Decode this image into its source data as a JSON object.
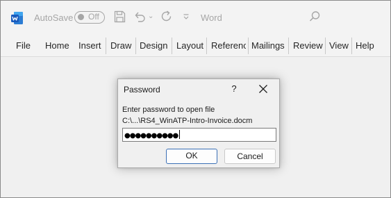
{
  "titlebar": {
    "app_icon": "word-icon",
    "autosave_label": "AutoSave",
    "autosave_state": "Off",
    "save_icon": "save-icon",
    "undo_icon": "undo-icon",
    "redo_icon": "redo-icon",
    "customize_icon": "customize-toolbar-icon",
    "app_name": "Word",
    "search_icon": "search-icon"
  },
  "ribbon": {
    "tabs": [
      "File",
      "Home",
      "Insert",
      "Draw",
      "Design",
      "Layout",
      "Referenc",
      "Mailings",
      "Review",
      "View",
      "Help"
    ]
  },
  "dialog": {
    "title": "Password",
    "help_label": "?",
    "close_icon": "close-icon",
    "prompt": "Enter password to open file",
    "file_path": "C:\\...\\RS4_WinATP-Intro-Invoice.docm",
    "password_value": "●●●●●●●●●●",
    "ok_label": "OK",
    "cancel_label": "Cancel"
  },
  "colors": {
    "word_blue": "#185abd",
    "focus_border": "#3a6fb5",
    "disabled_gray": "#a6a6a6"
  }
}
